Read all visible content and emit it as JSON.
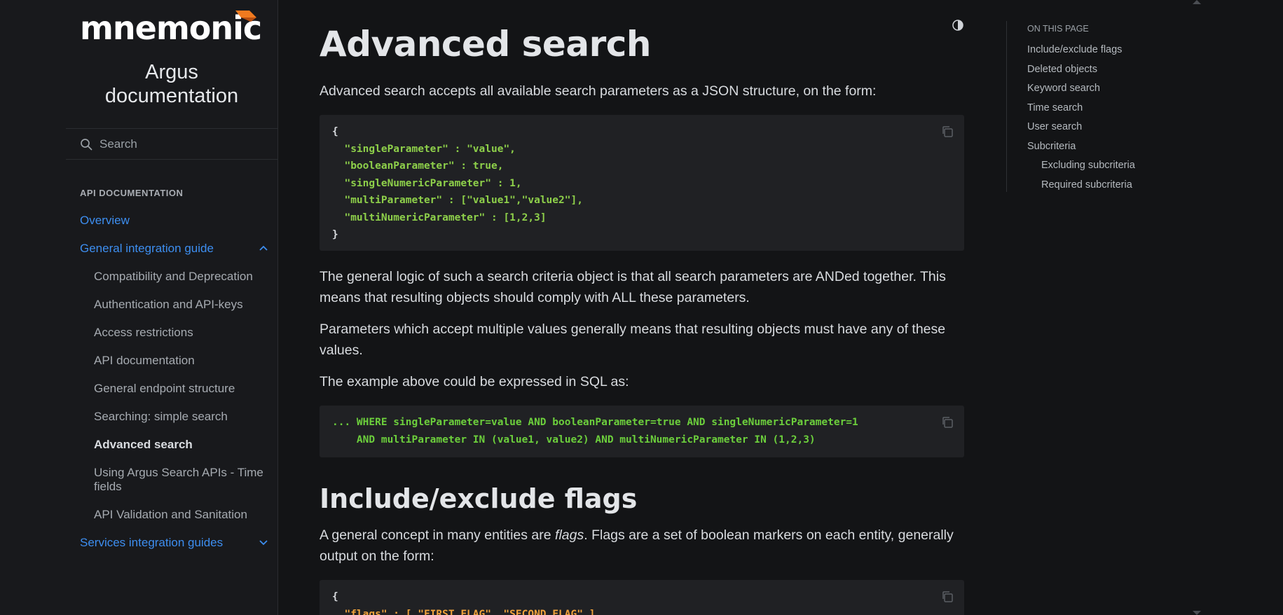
{
  "brand": {
    "logo_text": "mnemonic",
    "site_title": "Argus documentation",
    "accent": "#f07a1f"
  },
  "search": {
    "placeholder": "Search"
  },
  "nav": {
    "heading": "API DOCUMENTATION",
    "overview": "Overview",
    "group": "General integration guide",
    "items": [
      "Compatibility and Deprecation",
      "Authentication and API-keys",
      "Access restrictions",
      "API documentation",
      "General endpoint structure",
      "Searching: simple search",
      "Advanced search",
      "Using Argus Search APIs - Time fields",
      "API Validation and Sanitation"
    ],
    "services": "Services integration guides"
  },
  "content": {
    "title": "Advanced search",
    "intro": "Advanced search accepts all available search parameters as a JSON structure, on the form:",
    "code1": [
      "{",
      "\"singleParameter\" : \"value\",",
      "\"booleanParameter\" : true,",
      "\"singleNumericParameter\" : 1,",
      "\"multiParameter\" : [\"value1\",\"value2\"],",
      "\"multiNumericParameter\" : [1,2,3]",
      "}"
    ],
    "p2": "The general logic of such a search criteria object is that all search parameters are ANDed together. This means that resulting objects should comply with ALL these parameters.",
    "p3": "Parameters which accept multiple values generally means that resulting objects must have any of these values.",
    "p4": "The example above could be expressed in SQL as:",
    "sql1": "... WHERE singleParameter=value AND booleanParameter=true AND singleNumericParameter=1",
    "sql2": "    AND multiParameter IN (value1, value2) AND multiNumericParameter IN (1,2,3)",
    "section": "Include/exclude flags",
    "p5_a": "A general concept in many entities are ",
    "p5_em": "flags",
    "p5_b": ". Flags are a set of boolean markers on each entity, generally output on the form:",
    "code3_line1": "{",
    "code3_line2": "  \"flags\" : [ \"FIRST_FLAG\", \"SECOND_FLAG\" ]"
  },
  "toc": {
    "heading": "ON THIS PAGE",
    "items": [
      "Include/exclude flags",
      "Deleted objects",
      "Keyword search",
      "Time search",
      "User search",
      "Subcriteria"
    ],
    "sub_items": [
      "Excluding subcriteria",
      "Required subcriteria"
    ]
  },
  "colors": {
    "link": "#3d8ef0",
    "background": "#131416",
    "code_bg": "#202124"
  }
}
